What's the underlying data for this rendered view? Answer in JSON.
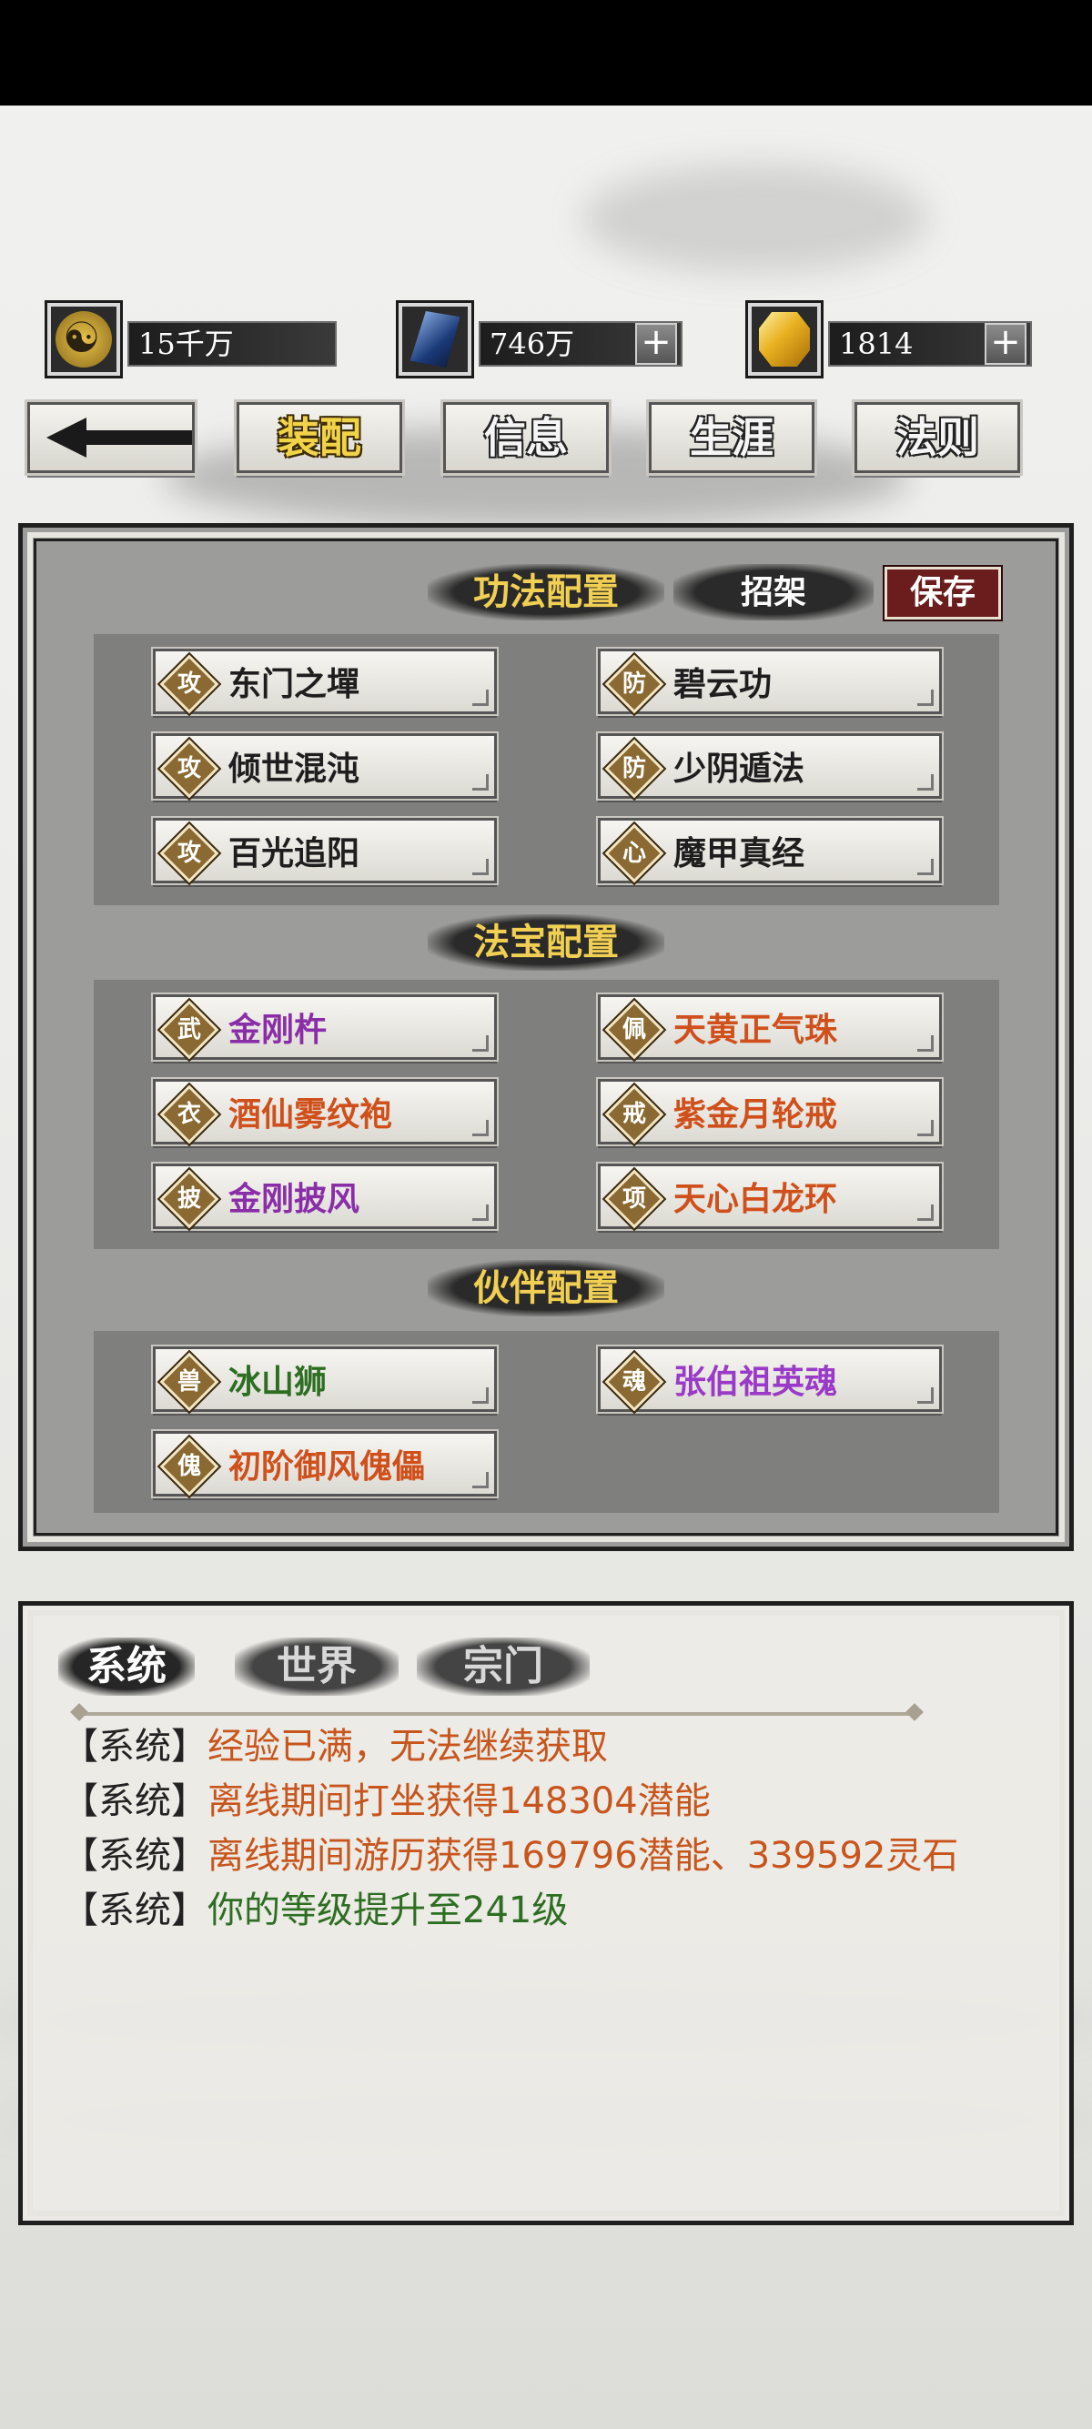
{
  "currencies": [
    {
      "icon": "yinyang-coin-icon",
      "value": "15千万"
    },
    {
      "icon": "spirit-crystal-icon",
      "value": "746万"
    },
    {
      "icon": "gold-ingot-icon",
      "value": "1814"
    }
  ],
  "plus_glyph": "+",
  "nav": {
    "tabs": [
      {
        "label": "装配",
        "active": true
      },
      {
        "label": "信息",
        "active": false
      },
      {
        "label": "生涯",
        "active": false
      },
      {
        "label": "法则",
        "active": false
      }
    ]
  },
  "skills": {
    "title": "功法配置",
    "block_tab": "招架",
    "save_label": "保存",
    "items": [
      {
        "badge": "攻",
        "name": "东门之墠",
        "color": "#1e1e1e"
      },
      {
        "badge": "防",
        "name": "碧云功",
        "color": "#1e1e1e"
      },
      {
        "badge": "攻",
        "name": "倾世混沌",
        "color": "#1e1e1e"
      },
      {
        "badge": "防",
        "name": "少阴遁法",
        "color": "#1e1e1e"
      },
      {
        "badge": "攻",
        "name": "百光追阳",
        "color": "#1e1e1e"
      },
      {
        "badge": "心",
        "name": "魔甲真经",
        "color": "#1e1e1e"
      }
    ]
  },
  "treasures": {
    "title": "法宝配置",
    "items": [
      {
        "badge": "武",
        "name": "金刚杵",
        "color": "#8a2ea8"
      },
      {
        "badge": "佩",
        "name": "天黄正气珠",
        "color": "#d0501c"
      },
      {
        "badge": "衣",
        "name": "酒仙雾纹袍",
        "color": "#d0501c"
      },
      {
        "badge": "戒",
        "name": "紫金月轮戒",
        "color": "#d0501c"
      },
      {
        "badge": "披",
        "name": "金刚披风",
        "color": "#8a2ea8"
      },
      {
        "badge": "项",
        "name": "天心白龙环",
        "color": "#d0501c"
      }
    ]
  },
  "companions": {
    "title": "伙伴配置",
    "items": [
      {
        "badge": "兽",
        "name": "冰山狮",
        "color": "#2d6e22"
      },
      {
        "badge": "魂",
        "name": "张伯祖英魂",
        "color": "#9a3ac8"
      },
      {
        "badge": "傀",
        "name": "初阶御风傀儡",
        "color": "#d0501c"
      }
    ]
  },
  "chat": {
    "tabs": [
      "系统",
      "世界",
      "宗门"
    ],
    "messages": [
      {
        "tag": "【系统】",
        "text": "经验已满，无法继续获取",
        "color": "orange"
      },
      {
        "tag": "【系统】",
        "text": "离线期间打坐获得148304潜能",
        "color": "orange"
      },
      {
        "tag": "【系统】",
        "text": "离线期间游历获得169796潜能、339592灵石",
        "color": "orange"
      },
      {
        "tag": "【系统】",
        "text": "你的等级提升至241级",
        "color": "green"
      }
    ]
  }
}
